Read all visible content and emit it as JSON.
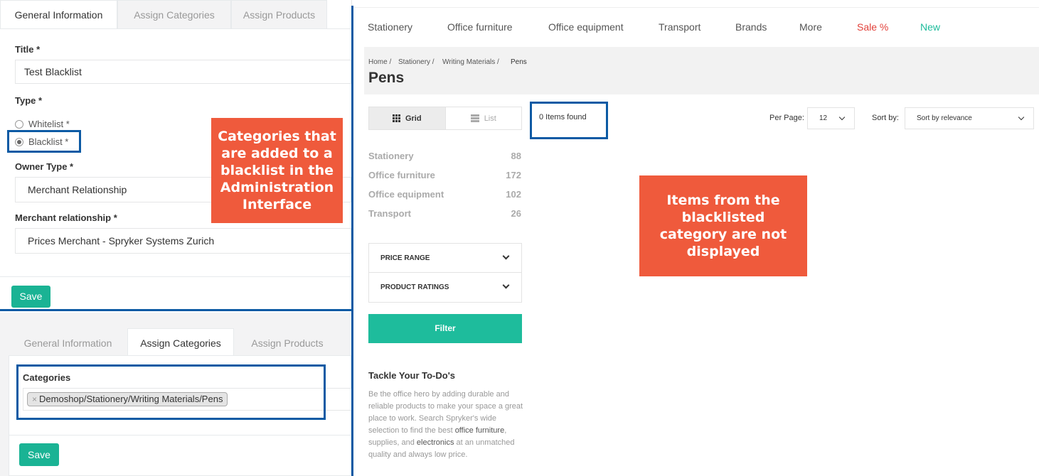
{
  "admin_top": {
    "tabs": [
      "General Information",
      "Assign Categories",
      "Assign Products"
    ],
    "title_label": "Title *",
    "title_value": "Test Blacklist",
    "type_label": "Type *",
    "radio_whitelist": "Whitelist *",
    "radio_blacklist": "Blacklist *",
    "owner_type_label": "Owner Type *",
    "owner_type_value": "Merchant Relationship",
    "merchant_label": "Merchant relationship *",
    "merchant_value": "Prices Merchant - Spryker Systems Zurich",
    "save": "Save"
  },
  "admin_bottom": {
    "tabs": [
      "General Information",
      "Assign Categories",
      "Assign Products"
    ],
    "categories_label": "Categories",
    "chip_remove": "×",
    "chip_value": "Demoshop/Stationery/Writing Materials/Pens",
    "save": "Save"
  },
  "callouts": {
    "admin": "Categories that are added to a blacklist in the Administration Interface",
    "shop": "Items from the blacklisted category are not displayed"
  },
  "shop": {
    "nav": [
      "Stationery",
      "Office furniture",
      "Office equipment",
      "Transport",
      "Brands",
      "More",
      "Sale %",
      "New"
    ],
    "breadcrumb": [
      "Home /",
      "Stationery /",
      "Writing Materials /",
      "Pens"
    ],
    "page_title": "Pens",
    "view": {
      "grid": "Grid",
      "list": "List"
    },
    "items_found": "0 Items found",
    "per_page_label": "Per Page:",
    "per_page_value": "12",
    "sort_label": "Sort by:",
    "sort_value": "Sort by relevance",
    "categories": [
      {
        "name": "Stationery",
        "count": "88"
      },
      {
        "name": "Office furniture",
        "count": "172"
      },
      {
        "name": "Office equipment",
        "count": "102"
      },
      {
        "name": "Transport",
        "count": "26"
      }
    ],
    "filters": [
      "PRICE RANGE",
      "PRODUCT RATINGS"
    ],
    "filter_button": "Filter",
    "promo_title": "Tackle Your To-Do's",
    "promo_1": "Be the office hero by adding durable and reliable products to make your space a great place to work. Search Spryker's wide selection to find the best ",
    "promo_b1": "office furniture",
    "promo_2": ", supplies, and ",
    "promo_b2": "electronics",
    "promo_3": " at an unmatched quality and always low price."
  },
  "colors": {
    "accent_green": "#1ab394",
    "highlight_blue": "#0c5aa4",
    "callout_red": "#ef5a3c",
    "sale_red": "#e2413a",
    "new_green": "#1ebc9c"
  }
}
